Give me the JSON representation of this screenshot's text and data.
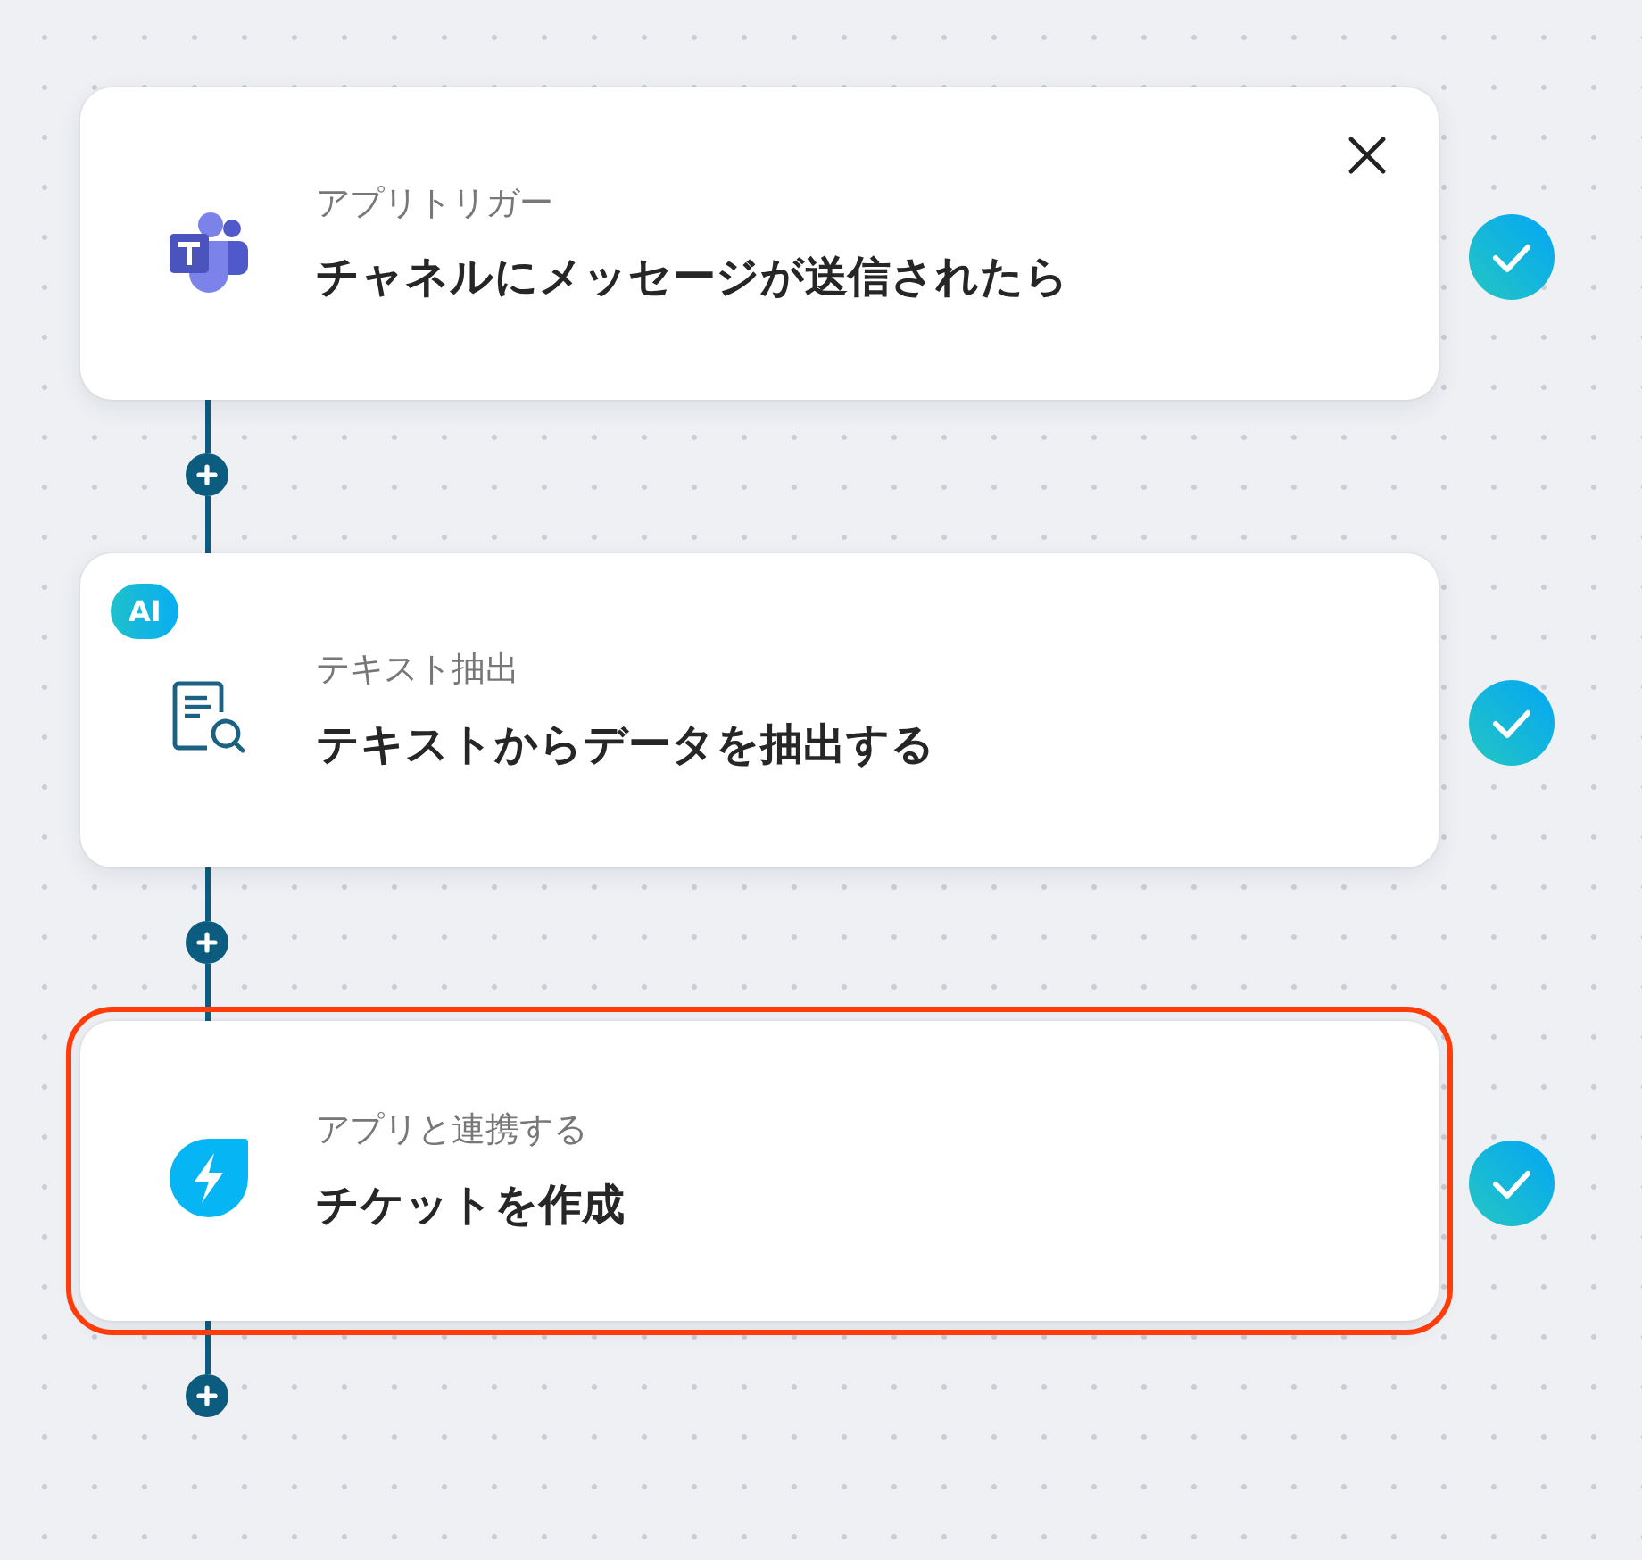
{
  "steps": [
    {
      "kind": "trigger",
      "category": "アプリトリガー",
      "title": "チャネルにメッセージが送信されたら",
      "closable": true,
      "completed": true,
      "selected": false
    },
    {
      "kind": "extract",
      "badge": "AI",
      "category": "テキスト抽出",
      "title": "テキストからデータを抽出する",
      "closable": false,
      "completed": true,
      "selected": false
    },
    {
      "kind": "action",
      "category": "アプリと連携する",
      "title": "チケットを作成",
      "closable": false,
      "completed": true,
      "selected": true
    }
  ]
}
